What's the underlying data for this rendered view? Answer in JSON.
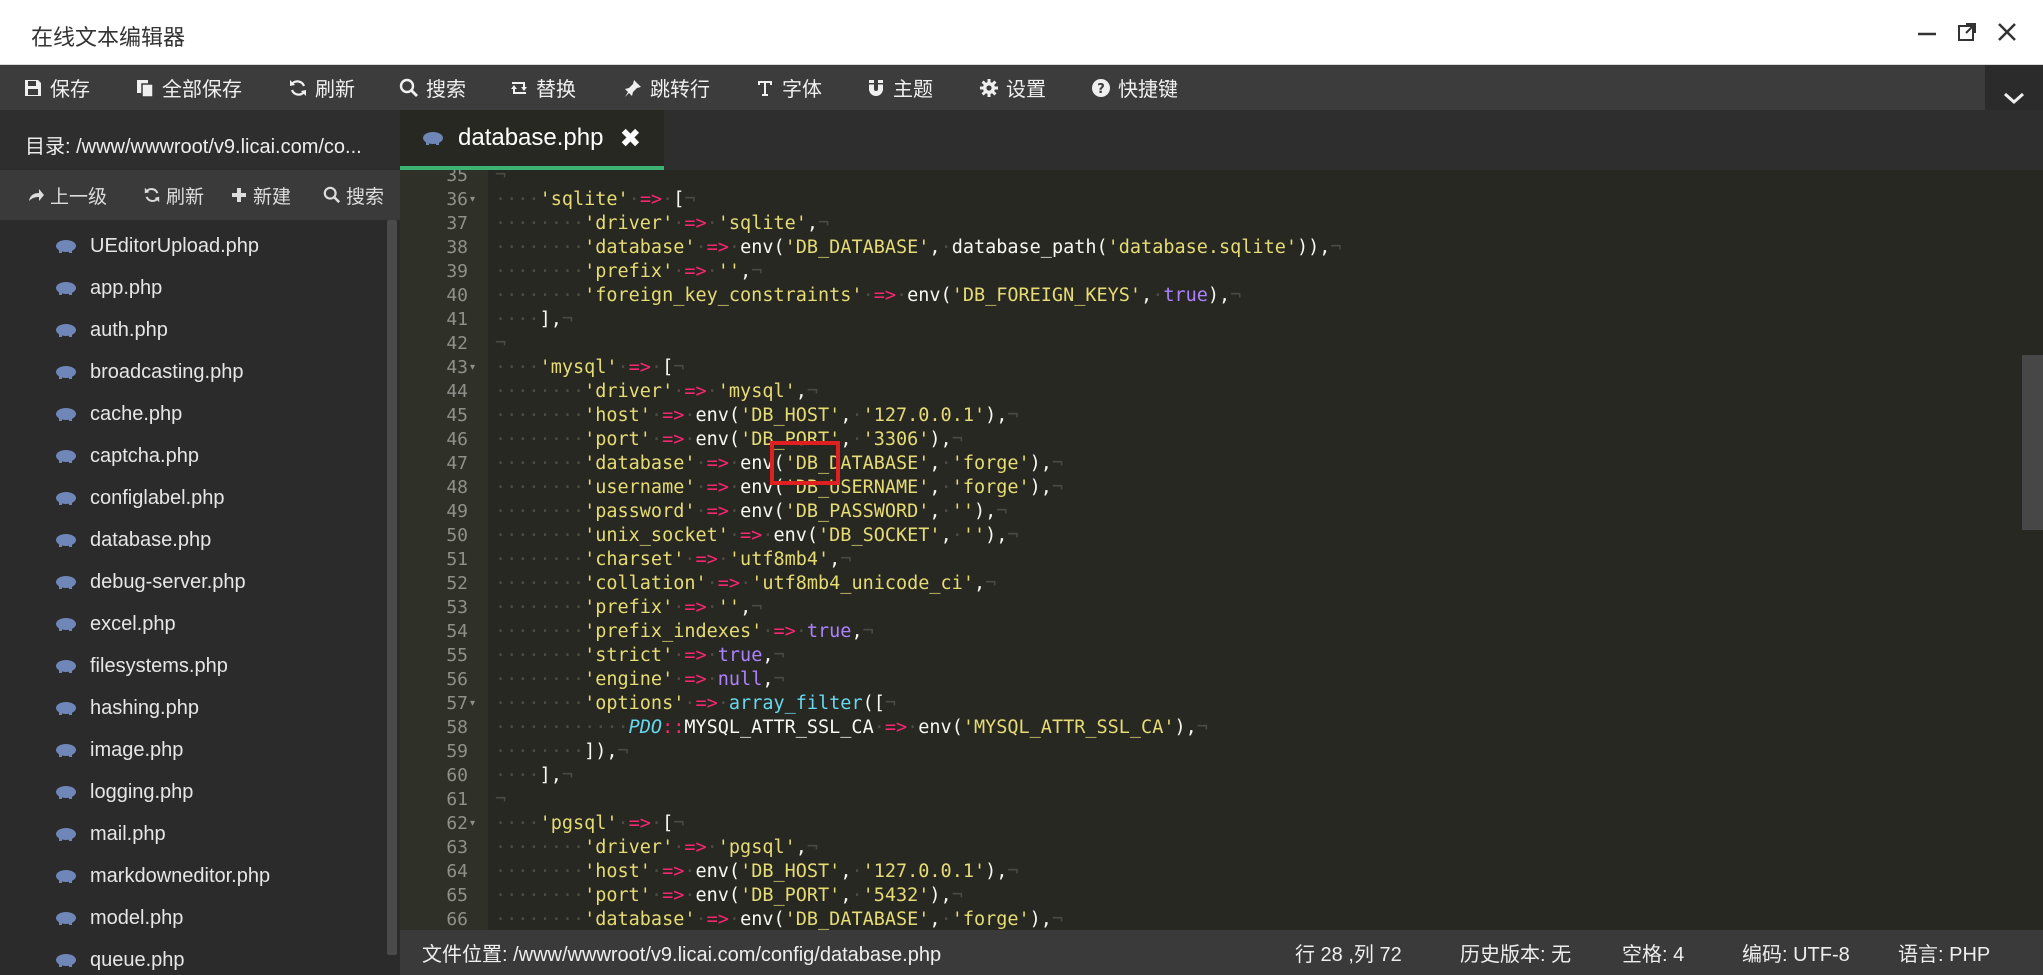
{
  "window": {
    "title": "在线文本编辑器"
  },
  "toolbar": {
    "buttons": [
      {
        "label": "保存",
        "icon": "save-icon"
      },
      {
        "label": "全部保存",
        "icon": "copy-icon"
      },
      {
        "label": "刷新",
        "icon": "refresh-icon"
      },
      {
        "label": "搜索",
        "icon": "search-icon"
      },
      {
        "label": "替换",
        "icon": "replace-icon"
      },
      {
        "label": "跳转行",
        "icon": "pin-icon"
      },
      {
        "label": "字体",
        "icon": "text-icon"
      },
      {
        "label": "主题",
        "icon": "magnet-icon"
      },
      {
        "label": "设置",
        "icon": "gear-icon"
      },
      {
        "label": "快捷键",
        "icon": "question-icon"
      }
    ]
  },
  "sidebar": {
    "path_label": "目录: /www/wwwroot/v9.licai.com/co...",
    "actions": [
      {
        "label": "上一级",
        "icon": "share-icon"
      },
      {
        "label": "刷新",
        "icon": "refresh-icon"
      },
      {
        "label": "新建",
        "icon": "plus-icon"
      },
      {
        "label": "搜索",
        "icon": "search-icon"
      }
    ],
    "files": [
      "UEditorUpload.php",
      "app.php",
      "auth.php",
      "broadcasting.php",
      "cache.php",
      "captcha.php",
      "configlabel.php",
      "database.php",
      "debug-server.php",
      "excel.php",
      "filesystems.php",
      "hashing.php",
      "image.php",
      "logging.php",
      "mail.php",
      "markdowneditor.php",
      "model.php",
      "queue.php"
    ]
  },
  "tab": {
    "filename": "database.php",
    "close_glyph": "✖"
  },
  "editor": {
    "line_numbers": [
      "35",
      "36",
      "37",
      "38",
      "39",
      "40",
      "41",
      "42",
      "43",
      "44",
      "45",
      "46",
      "47",
      "48",
      "49",
      "50",
      "51",
      "52",
      "53",
      "54",
      "55",
      "56",
      "57",
      "58",
      "59",
      "60",
      "61",
      "62",
      "63",
      "64",
      "65",
      "66"
    ],
    "lines": [
      "",
      "    'sqlite' => [",
      "        'driver' => 'sqlite',",
      "        'database' => env('DB_DATABASE', database_path('database.sqlite')),",
      "        'prefix' => '',",
      "        'foreign_key_constraints' => env('DB_FOREIGN_KEYS', true),",
      "    ],",
      "",
      "    'mysql' => [",
      "        'driver' => 'mysql',",
      "        'host' => env('DB_HOST', '127.0.0.1'),",
      "        'port' => env('DB_PORT', '3306'),",
      "        'database' => env('DB_DATABASE', 'forge'),",
      "        'username' => env('DB_USERNAME', 'forge'),",
      "        'password' => env('DB_PASSWORD', ''),",
      "        'unix_socket' => env('DB_SOCKET', ''),",
      "        'charset' => 'utf8mb4',",
      "        'collation' => 'utf8mb4_unicode_ci',",
      "        'prefix' => '',",
      "        'prefix_indexes' => true,",
      "        'strict' => true,",
      "        'engine' => null,",
      "        'options' => array_filter([",
      "            PDO::MYSQL_ATTR_SSL_CA => env('MYSQL_ATTR_SSL_CA'),",
      "        ]),",
      "    ],",
      "",
      "    'pgsql' => [",
      "        'driver' => 'pgsql',",
      "        'host' => env('DB_HOST', '127.0.0.1'),",
      "        'port' => env('DB_PORT', '5432'),",
      "        'database' => env('DB_DATABASE', 'forge'),"
    ],
    "fold_lines": [
      "36",
      "43",
      "57",
      "62"
    ]
  },
  "statusbar": {
    "file_location": "文件位置: /www/wwwroot/v9.licai.com/config/database.php",
    "cursor": "行 28 ,列 72",
    "history": "历史版本: 无",
    "spaces": "空格: 4",
    "encoding": "编码: UTF-8",
    "language": "语言: PHP"
  },
  "colors": {
    "accent": "#3cb371",
    "highlight_box": "#e02020",
    "editor_bg": "#272822"
  }
}
